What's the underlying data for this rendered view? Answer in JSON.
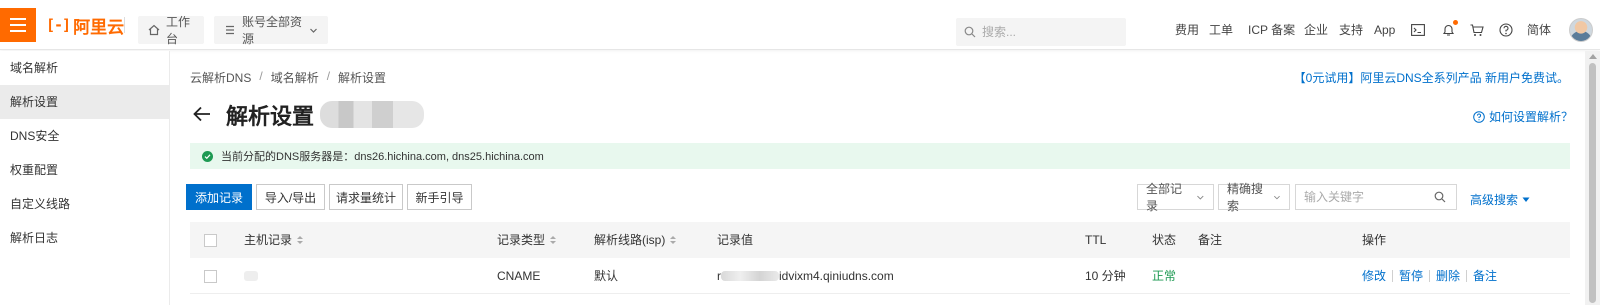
{
  "topbar": {
    "logo_text": "阿里云",
    "workbench": "工作台",
    "account_resources": "账号全部资源",
    "search_placeholder": "搜索...",
    "links": [
      "费用",
      "工单",
      "ICP 备案",
      "企业",
      "支持",
      "App"
    ],
    "lang": "简体",
    "icons": [
      "terminal-icon",
      "bell-icon",
      "cart-icon",
      "help-icon"
    ]
  },
  "sidebar": {
    "title": "域名解析",
    "items": [
      {
        "label": "解析设置",
        "active": true
      },
      {
        "label": "DNS安全",
        "active": false
      },
      {
        "label": "权重配置",
        "active": false
      },
      {
        "label": "自定义线路",
        "active": false
      },
      {
        "label": "解析日志",
        "active": false
      }
    ]
  },
  "breadcrumb": [
    "云解析DNS",
    "域名解析",
    "解析设置"
  ],
  "promo": "【0元试用】阿里云DNS全系列产品 新用户免费试。",
  "page": {
    "title": "解析设置",
    "help": "如何设置解析？",
    "notice": "当前分配的DNS服务器是：dns26.hichina.com, dns25.hichina.com"
  },
  "toolbar": {
    "add": "添加记录",
    "import_export": "导入/导出",
    "stats": "请求量统计",
    "guide": "新手引导",
    "filter_all": "全部记录",
    "precise": "精确搜索",
    "keyword_placeholder": "输入关键字",
    "advanced": "高级搜索"
  },
  "table": {
    "columns": [
      "主机记录",
      "记录类型",
      "解析线路(isp)",
      "记录值",
      "TTL",
      "状态",
      "备注",
      "操作"
    ],
    "rows": [
      {
        "host": "",
        "type": "CNAME",
        "line": "默认",
        "value_prefix": "r",
        "value": "idvixm4.qiniudns.com",
        "ttl": "10 分钟",
        "status": "正常",
        "remark": "",
        "actions": [
          "修改",
          "暂停",
          "删除",
          "备注"
        ]
      }
    ]
  },
  "colors": {
    "brand": "#ff6a00",
    "link": "#0070cc",
    "success": "#1e9a53",
    "notice_bg": "#e8f8ee"
  }
}
